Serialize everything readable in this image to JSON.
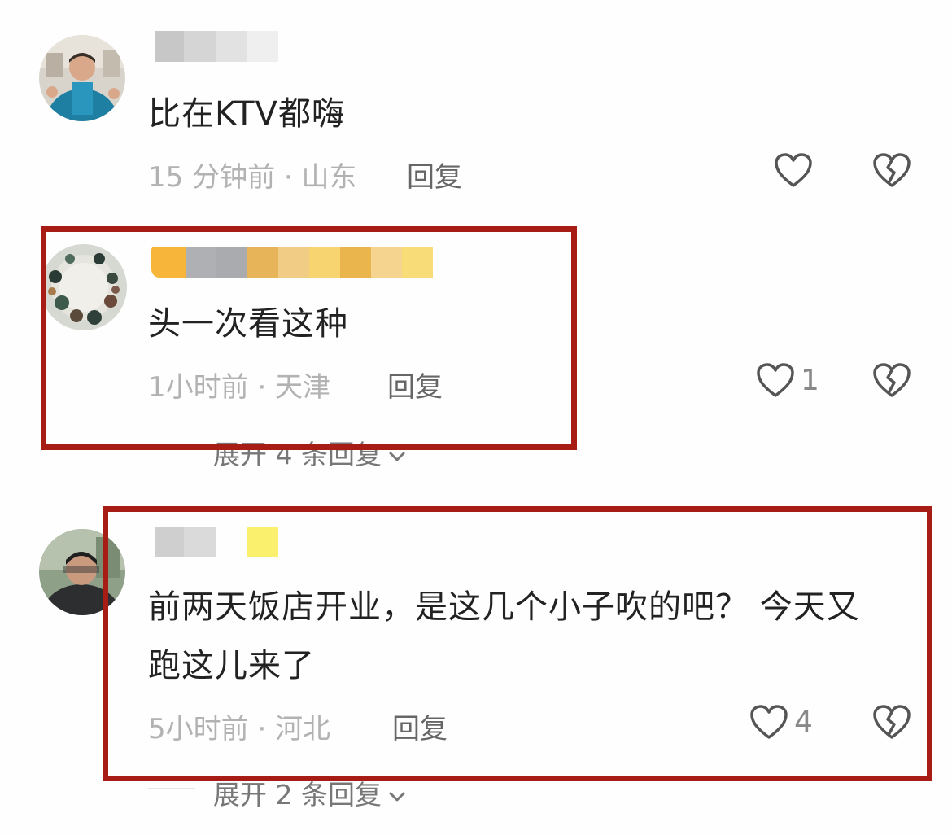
{
  "comments": [
    {
      "text": "比在KTV都嗨",
      "time": "15 分钟前 · 山东",
      "reply_label": "回复",
      "like_count": ""
    },
    {
      "text": "头一次看这种",
      "time": "1小时前 · 天津",
      "reply_label": "回复",
      "like_count": "1",
      "expand_label": "展开 4 条回复"
    },
    {
      "text_line1": "前两天饭店开业，是这几个小子吹的吧？ 今天又",
      "text_line2": "跑这儿来了",
      "time": "5小时前 · 河北",
      "reply_label": "回复",
      "like_count": "4",
      "expand_label": "展开 2 条回复"
    }
  ],
  "colors": {
    "highlight_border": "#a71d16",
    "body_text": "#222222",
    "meta_text": "#b2b2b2",
    "reply_text": "#666666"
  },
  "icons": {
    "like": "heart-outline-icon",
    "dislike": "broken-heart-icon",
    "expand": "chevron-down-icon"
  }
}
